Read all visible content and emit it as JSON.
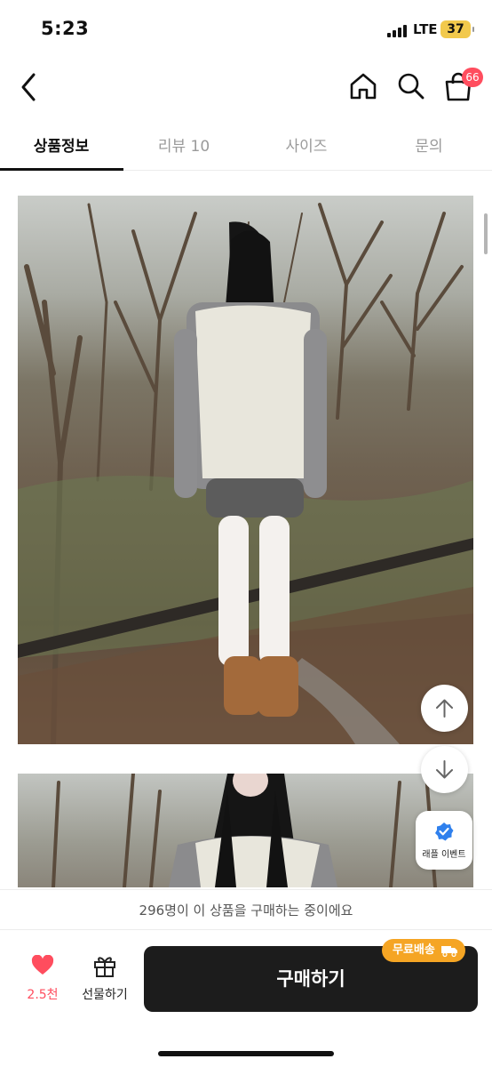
{
  "status_bar": {
    "time": "5:23",
    "network": "LTE",
    "battery": "37"
  },
  "nav": {
    "cart_badge": "66"
  },
  "tabs": [
    {
      "label": "상품정보",
      "active": true
    },
    {
      "label": "리뷰 10",
      "active": false
    },
    {
      "label": "사이즈",
      "active": false
    },
    {
      "label": "문의",
      "active": false
    }
  ],
  "floating": {
    "raffle_label": "래플 이벤트"
  },
  "notice": "296명이 이 상품을 구매하는 중이에요",
  "bottom_bar": {
    "like_count": "2.5천",
    "gift_label": "선물하기",
    "buy_label": "구매하기",
    "free_shipping_badge": "무료배송"
  },
  "colors": {
    "accent": "#ff4d5e",
    "buy_button": "#1c1c1c",
    "free_shipping": "#f5a524",
    "raffle_check": "#2f80ed"
  }
}
